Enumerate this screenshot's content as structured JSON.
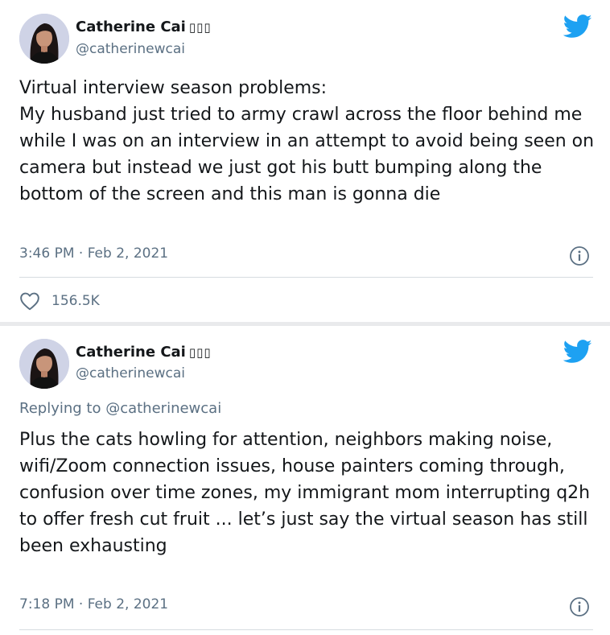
{
  "colors": {
    "twitter_blue": "#1da1f2",
    "secondary_text": "#5b7083",
    "primary_text": "#14171a"
  },
  "tweets": [
    {
      "display_name": "Catherine Cai",
      "name_emoji": "▯▯▯",
      "handle": "@catherinewcai",
      "text": "Virtual interview season problems:\nMy husband just tried to army crawl across the floor behind me while I was on an interview in an attempt to avoid being seen on camera but instead we just got his butt bumping along the bottom of the screen and this man is gonna die",
      "timestamp": "3:46 PM · Feb 2, 2021",
      "like_count": "156.5K",
      "icons": [
        "avatar",
        "twitter-bird-icon",
        "info-icon",
        "heart-icon"
      ]
    },
    {
      "display_name": "Catherine Cai",
      "name_emoji": "▯▯▯",
      "handle": "@catherinewcai",
      "replying_to": "Replying to @catherinewcai",
      "text": "Plus the cats howling for attention, neighbors making noise, wifi/Zoom connection issues, house painters coming through, confusion over time zones, my immigrant mom interrupting q2h to offer fresh cut fruit ... let’s just say the virtual season has still been exhausting",
      "timestamp": "7:18 PM · Feb 2, 2021",
      "icons": [
        "avatar",
        "twitter-bird-icon",
        "info-icon"
      ]
    }
  ]
}
